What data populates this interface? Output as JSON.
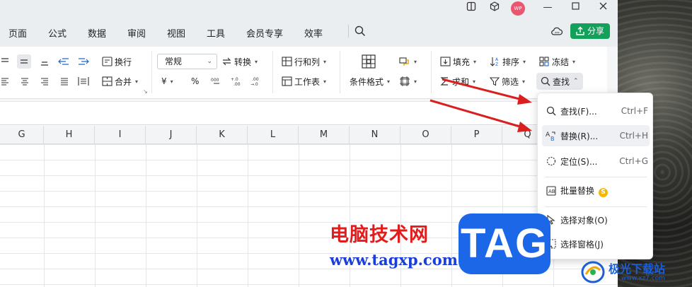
{
  "menu": [
    "页面",
    "公式",
    "数据",
    "审阅",
    "视图",
    "工具",
    "会员专享",
    "效率"
  ],
  "avatar": "WP",
  "share_label": "分享",
  "ribbon": {
    "wrap": "换行",
    "merge": "合并",
    "format_select": "常规",
    "convert": "转换",
    "row_col": "行和列",
    "worksheet": "工作表",
    "cond_format": "条件格式",
    "fill": "填充",
    "sort": "排序",
    "freeze": "冻结",
    "sum": "求和",
    "filter": "筛选",
    "find": "查找",
    "yen": "¥",
    "percent": "%"
  },
  "columns": [
    "G",
    "H",
    "I",
    "J",
    "K",
    "L",
    "M",
    "N",
    "O",
    "P",
    "Q"
  ],
  "dropdown": {
    "find": {
      "label": "查找(F)...",
      "shortcut": "Ctrl+F"
    },
    "replace": {
      "label": "替换(R)...",
      "shortcut": "Ctrl+H"
    },
    "goto": {
      "label": "定位(S)...",
      "shortcut": "Ctrl+G"
    },
    "batch_replace": {
      "label": "批量替换"
    },
    "select_obj": {
      "label": "选择对象(O)"
    },
    "select_pane": {
      "label": "选择窗格(J)"
    }
  },
  "watermark": {
    "cn": "电脑技术网",
    "url": "www.tagxp.com",
    "tag": "TAG",
    "jg": "极光下载站",
    "jg_url": "www.xz7.com"
  },
  "colors": {
    "accent": "#12a05b",
    "arrow": "#d9201f",
    "tag_blue": "#1c66e8"
  }
}
